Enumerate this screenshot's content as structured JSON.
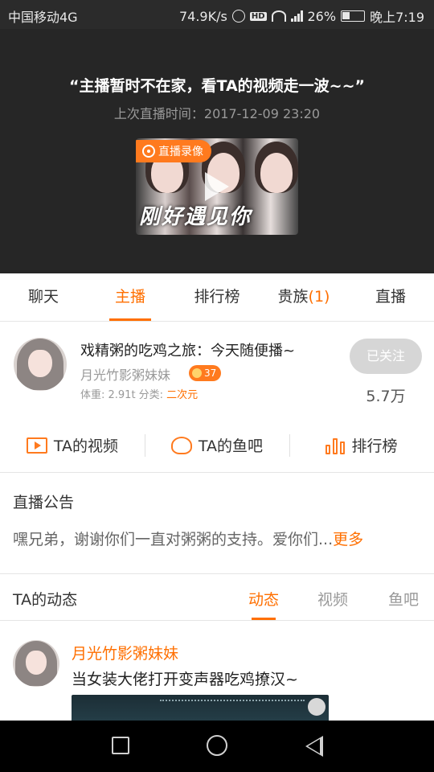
{
  "status_bar": {
    "carrier": "中国移动4G",
    "net_speed": "74.9K/s",
    "hd_label": "HD",
    "battery": "26%",
    "battery_level": 0.26,
    "time": "晚上7:19"
  },
  "hero": {
    "message": "“主播暂时不在家，看TA的视频走一波~~”",
    "last_live": "上次直播时间：2017-12-09  23:20",
    "video_tag": "直播录像",
    "video_caption": "刚好遇见你"
  },
  "tabs": [
    {
      "label": "聊天",
      "count": ""
    },
    {
      "label": "主播",
      "count": ""
    },
    {
      "label": "排行榜",
      "count": ""
    },
    {
      "label": "贵族",
      "count": "(1)"
    },
    {
      "label": "直播",
      "count": ""
    }
  ],
  "active_tab": 1,
  "anchor": {
    "room_title": "戏精粥的吃鸡之旅：今天随便播~",
    "name": "月光竹影粥妹妹",
    "level": "37",
    "weight_label": "体重: 2.91t  分类:",
    "category": "二次元",
    "follow_label": "已关注",
    "followers": "5.7万"
  },
  "quick_links": {
    "videos": "TA的视频",
    "fishbar": "TA的鱼吧",
    "ranking": "排行榜"
  },
  "announcement": {
    "title": "直播公告",
    "text": "嘿兄弟，谢谢你们一直对粥粥的支持。爱你们...",
    "more": "更多"
  },
  "dynamics": {
    "title": "TA的动态",
    "tabs": [
      "动态",
      "视频",
      "鱼吧"
    ],
    "post": {
      "author": "月光竹影粥妹妹",
      "text": "当女装大佬打开变声器吃鸡撩汉~"
    }
  },
  "colors": {
    "accent": "#ff6f00",
    "hero_bg": "#262626",
    "follow_btn": "#d6d6d6"
  }
}
